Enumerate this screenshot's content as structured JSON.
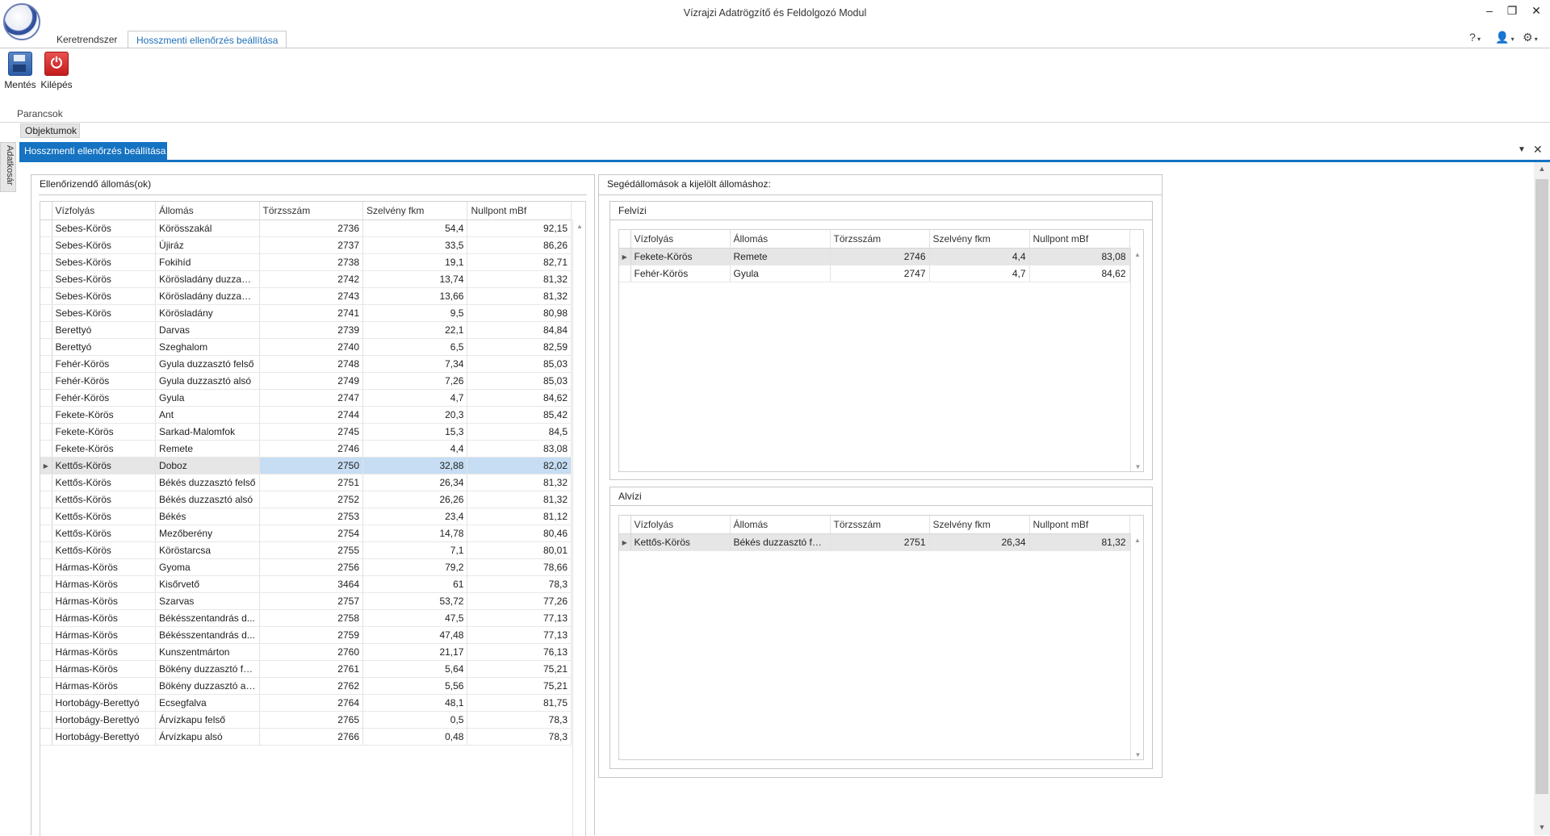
{
  "window": {
    "title": "Vízrajzi Adatrögzítő és Feldolgozó Modul"
  },
  "ribbon": {
    "tabs": [
      "Keretrendszer",
      "Hosszmenti ellenőrzés beállítása"
    ],
    "buttons": {
      "save": "Mentés",
      "exit": "Kilépés"
    },
    "group_label": "Parancsok"
  },
  "objects_tab": "Objektumok",
  "side_rail": "Adatkosár",
  "document_tab": "Hosszmenti ellenőrzés beállítása",
  "columns": [
    "Vízfolyás",
    "Állomás",
    "Törzsszám",
    "Szelvény fkm",
    "Nullpont mBf"
  ],
  "left_panel": {
    "title": "Ellenőrizendő állomás(ok)",
    "selected_index": 14,
    "rows": [
      [
        "Sebes-Körös",
        "Körösszakál",
        "2736",
        "54,4",
        "92,15"
      ],
      [
        "Sebes-Körös",
        "Újiráz",
        "2737",
        "33,5",
        "86,26"
      ],
      [
        "Sebes-Körös",
        "Fokihíd",
        "2738",
        "19,1",
        "82,71"
      ],
      [
        "Sebes-Körös",
        "Körösladány duzzasz...",
        "2742",
        "13,74",
        "81,32"
      ],
      [
        "Sebes-Körös",
        "Körösladány duzzasz...",
        "2743",
        "13,66",
        "81,32"
      ],
      [
        "Sebes-Körös",
        "Körösladány",
        "2741",
        "9,5",
        "80,98"
      ],
      [
        "Berettyó",
        "Darvas",
        "2739",
        "22,1",
        "84,84"
      ],
      [
        "Berettyó",
        "Szeghalom",
        "2740",
        "6,5",
        "82,59"
      ],
      [
        "Fehér-Körös",
        "Gyula duzzasztó felső",
        "2748",
        "7,34",
        "85,03"
      ],
      [
        "Fehér-Körös",
        "Gyula duzzasztó alsó",
        "2749",
        "7,26",
        "85,03"
      ],
      [
        "Fehér-Körös",
        "Gyula",
        "2747",
        "4,7",
        "84,62"
      ],
      [
        "Fekete-Körös",
        "Ant",
        "2744",
        "20,3",
        "85,42"
      ],
      [
        "Fekete-Körös",
        "Sarkad-Malomfok",
        "2745",
        "15,3",
        "84,5"
      ],
      [
        "Fekete-Körös",
        "Remete",
        "2746",
        "4,4",
        "83,08"
      ],
      [
        "Kettős-Körös",
        "Doboz",
        "2750",
        "32,88",
        "82,02"
      ],
      [
        "Kettős-Körös",
        "Békés duzzasztó felső",
        "2751",
        "26,34",
        "81,32"
      ],
      [
        "Kettős-Körös",
        "Békés duzzasztó alsó",
        "2752",
        "26,26",
        "81,32"
      ],
      [
        "Kettős-Körös",
        "Békés",
        "2753",
        "23,4",
        "81,12"
      ],
      [
        "Kettős-Körös",
        "Mezőberény",
        "2754",
        "14,78",
        "80,46"
      ],
      [
        "Kettős-Körös",
        "Köröstarcsa",
        "2755",
        "7,1",
        "80,01"
      ],
      [
        "Hármas-Körös",
        "Gyoma",
        "2756",
        "79,2",
        "78,66"
      ],
      [
        "Hármas-Körös",
        "Kisőrvető",
        "3464",
        "61",
        "78,3"
      ],
      [
        "Hármas-Körös",
        "Szarvas",
        "2757",
        "53,72",
        "77,26"
      ],
      [
        "Hármas-Körös",
        "Békésszentandrás d...",
        "2758",
        "47,5",
        "77,13"
      ],
      [
        "Hármas-Körös",
        "Békésszentandrás d...",
        "2759",
        "47,48",
        "77,13"
      ],
      [
        "Hármas-Körös",
        "Kunszentmárton",
        "2760",
        "21,17",
        "76,13"
      ],
      [
        "Hármas-Körös",
        "Bökény duzzasztó fe...",
        "2761",
        "5,64",
        "75,21"
      ],
      [
        "Hármas-Körös",
        "Bökény duzzasztó alsó",
        "2762",
        "5,56",
        "75,21"
      ],
      [
        "Hortobágy-Berettyó",
        "Ecsegfalva",
        "2764",
        "48,1",
        "81,75"
      ],
      [
        "Hortobágy-Berettyó",
        "Árvízkapu felső",
        "2765",
        "0,5",
        "78,3"
      ],
      [
        "Hortobágy-Berettyó",
        "Árvízkapu alsó",
        "2766",
        "0,48",
        "78,3"
      ]
    ]
  },
  "right_panel": {
    "title": "Segédállomások a kijelölt állomáshoz:",
    "upstream": {
      "title": "Felvízi",
      "selected_index": 0,
      "rows": [
        [
          "Fekete-Körös",
          "Remete",
          "2746",
          "4,4",
          "83,08"
        ],
        [
          "Fehér-Körös",
          "Gyula",
          "2747",
          "4,7",
          "84,62"
        ]
      ]
    },
    "downstream": {
      "title": "Alvízi",
      "selected_index": 0,
      "rows": [
        [
          "Kettős-Körös",
          "Békés duzzasztó felső",
          "2751",
          "26,34",
          "81,32"
        ]
      ]
    }
  }
}
